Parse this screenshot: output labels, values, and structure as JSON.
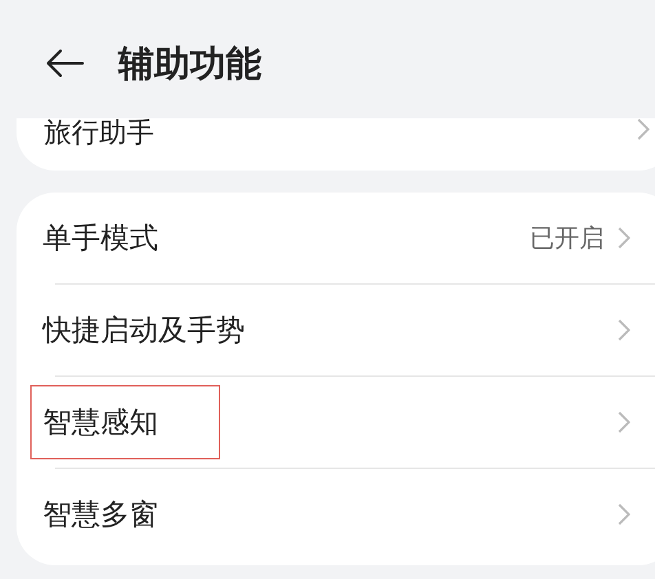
{
  "header": {
    "title": "辅助功能"
  },
  "top_card": {
    "items": [
      {
        "label": "旅行助手"
      }
    ]
  },
  "card": {
    "items": [
      {
        "label": "单手模式",
        "value": "已开启",
        "highlighted": false
      },
      {
        "label": "快捷启动及手势",
        "highlighted": false
      },
      {
        "label": "智慧感知",
        "highlighted": true
      },
      {
        "label": "智慧多窗",
        "highlighted": false
      }
    ]
  }
}
